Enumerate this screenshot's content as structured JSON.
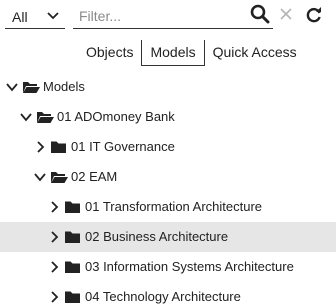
{
  "toolbar": {
    "scope_value": "All",
    "filter_placeholder": "Filter...",
    "filter_value": ""
  },
  "tabs": [
    {
      "label": "Objects",
      "active": false
    },
    {
      "label": "Models",
      "active": true
    },
    {
      "label": "Quick Access",
      "active": false
    }
  ],
  "tree": [
    {
      "label": "Models",
      "level": 0,
      "expanded": true,
      "selected": false
    },
    {
      "label": "01 ADOmoney Bank",
      "level": 1,
      "expanded": true,
      "selected": false
    },
    {
      "label": "01 IT Governance",
      "level": 2,
      "expanded": false,
      "selected": false
    },
    {
      "label": "02 EAM",
      "level": 2,
      "expanded": true,
      "selected": false
    },
    {
      "label": "01 Transformation Architecture",
      "level": 3,
      "expanded": false,
      "selected": false
    },
    {
      "label": "02 Business Architecture",
      "level": 3,
      "expanded": false,
      "selected": true
    },
    {
      "label": "03 Information Systems Architecture",
      "level": 3,
      "expanded": false,
      "selected": false
    },
    {
      "label": "04 Technology Architecture",
      "level": 3,
      "expanded": false,
      "selected": false
    }
  ],
  "icons": {
    "scope_chevron": "chevron-down-icon",
    "search": "search-icon",
    "clear": "close-icon",
    "refresh": "refresh-icon",
    "expanded": "chevron-down-icon",
    "collapsed": "chevron-right-icon",
    "folder_open": "folder-open-icon",
    "folder_closed": "folder-icon"
  },
  "colors": {
    "selected_row": "#e6e6e6",
    "icon": "#222222",
    "muted_icon": "#b5b5b5"
  }
}
